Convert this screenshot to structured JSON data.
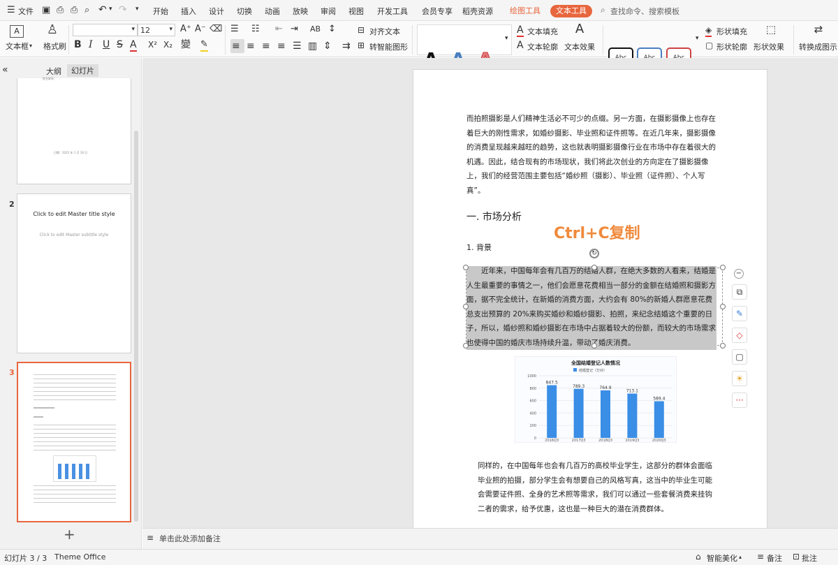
{
  "menu": {
    "file": "文件",
    "tabs": [
      "开始",
      "插入",
      "设计",
      "切换",
      "动画",
      "放映",
      "审阅",
      "视图",
      "开发工具",
      "会员专享",
      "稻壳资源"
    ],
    "draw_tools": "绘图工具",
    "text_tools": "文本工具",
    "search_placeholder": "查找命令、搜索模板"
  },
  "ribbon": {
    "textbox": "文本框",
    "format_painter": "格式刷",
    "font_size": "12",
    "align_text": "对齐文本",
    "smart_shape": "转智能图形",
    "text_fill": "文本填充",
    "text_outline": "文本轮廓",
    "text_effect": "文本效果",
    "art_letter": "A",
    "shape_sample": "Abc",
    "shape_fill": "形状填充",
    "shape_outline": "形状轮廓",
    "shape_effect": "形状效果",
    "convert_picture": "转换成图示"
  },
  "panel": {
    "tab_outline": "大纲",
    "tab_slides": "幻灯片",
    "collapse": "«",
    "add": "+",
    "slide1": {
      "line1": "姓名联系：",
      "line2": "日期：2022 年 1 月 18 日"
    },
    "slide2": {
      "num": "2",
      "title": "Click to edit Master title style",
      "subtitle": "Click to edit Master subtitle style"
    },
    "slide3": {
      "num": "3"
    }
  },
  "slide": {
    "p1": "而拍照摄影是人们精神生活必不可少的点缀。另一方面，在摄影摄像上也存在着巨大的刚性需求，如婚纱摄影、毕业照和证件照等。在近几年来，摄影摄像的消费呈现越来越旺的趋势，这也就表明摄影摄像行业在市场中存在着很大的机遇。因此，结合现有的市场现状，我们将此次创业的方向定在了摄影摄像上，我们的经营范围主要包括“婚纱照（摄影）、毕业照（证件照）、个人写真”。",
    "heading": "一. 市场分析",
    "overlay": "Ctrl+C复制",
    "subheading": "1. 背景",
    "selected_paragraph": "近年来，中国每年会有几百万的结婚人群，在绝大多数的人看来，结婚是人生最重要的事情之一，他们会愿意花费相当一部分的金额在结婚照和摄影方面，据不完全统计，在新婚的消费方面，大约会有 80%的新婚人群愿意花费总支出预算的 20%来购买婚纱和婚纱摄影、拍照，来纪念结婚这个重要的日子，所以，婚纱照和婚纱摄影在市场中占据着较大的份额，而较大的市场需求也使得中国的婚庆市场持续升温，带动了婚庆消费。",
    "p3": "同样的，在中国每年也会有几百万的高校毕业学生，这部分的群体会面临毕业照的拍摄，部分学生会有想要自己的风格写真，这当中的毕业生可能会需要证件照、全身的艺术照等需求，我们可以通过一些套餐消费来挂钩二者的需求，给予优惠，这也是一种巨大的潜在消费群体。"
  },
  "chart_data": {
    "type": "bar",
    "title": "全国结婚登记人数情况",
    "legend": [
      "结婚登记（万对）"
    ],
    "categories": [
      "2016Q3",
      "2017Q3",
      "2018Q3",
      "2019Q3",
      "2020Q3"
    ],
    "values": [
      847.5,
      789.3,
      764.9,
      713.1,
      589.4
    ],
    "value_labels": [
      "847.5",
      "789.3",
      "764.9",
      "713.1",
      "589.4"
    ],
    "ylim": [
      0,
      1000
    ],
    "yticks": [
      "0",
      "200",
      "400",
      "600",
      "800",
      "1000"
    ],
    "bar_color": "#3a8ee6"
  },
  "notes": "单击此处添加备注",
  "status": {
    "slide_counter": "幻灯片 3 / 3",
    "theme": "Theme Office",
    "beautify": "智能美化",
    "notes_btn": "备注",
    "comments_btn": "批注"
  },
  "colors": {
    "accent": "#e8663d",
    "overlay": "#f08a3c",
    "selection_bg": "#c8c8c8"
  }
}
